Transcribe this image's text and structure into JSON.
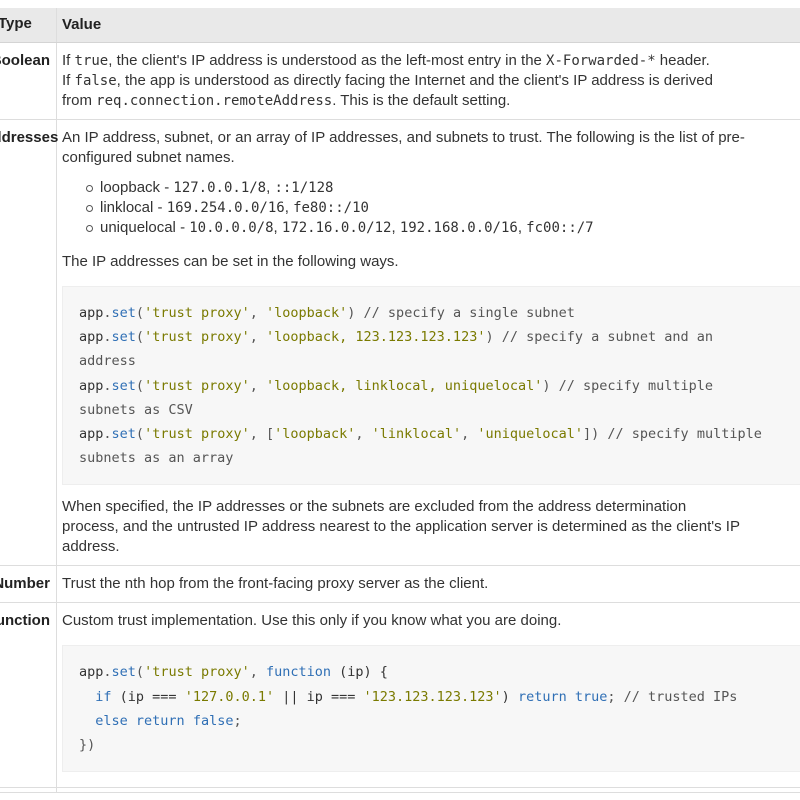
{
  "header": {
    "type": "Type",
    "value": "Value"
  },
  "boolean": {
    "type": "Boolean",
    "l1a": "If ",
    "l1b": "true",
    "l1c": ", the client's IP address is understood as the left-most entry in the ",
    "l1d": "X-Forwarded-*",
    "l1e": " header.",
    "l2a": "If ",
    "l2b": "false",
    "l2c": ", the app is understood as directly facing the Internet and the client's IP address is derived",
    "l3a": "from ",
    "l3b": "req.connection.remoteAddress",
    "l3c": ". This is the default setting."
  },
  "ip": {
    "type": "IP addresses",
    "l1": "An IP address, subnet, or an array of IP addresses, and subnets to trust. The following is the list of pre-",
    "l2": "configured subnet names.",
    "items": [
      {
        "name": "loopback",
        "sep": " - ",
        "a": "127.0.0.1/8",
        "comma": ", ",
        "b": "::1/128"
      },
      {
        "name": "linklocal",
        "sep": " - ",
        "a": "169.254.0.0/16",
        "comma": ", ",
        "b": "fe80::/10"
      },
      {
        "name": "uniquelocal",
        "sep": " - ",
        "a": "10.0.0.0/8",
        "c1": ", ",
        "b": "172.16.0.0/12",
        "c2": ", ",
        "c": "192.168.0.0/16",
        "c3": ", ",
        "d": "fc00::/7"
      }
    ],
    "ways": "The IP addresses can be set in the following ways.",
    "code": {
      "app": "app",
      "dot": ".",
      "set": "set",
      "r1": {
        "open": "(",
        "s1": "'trust proxy'",
        "sep": ", ",
        "s2": "'loopback'",
        "close": ")",
        "cm": " // specify a single subnet"
      },
      "r2": {
        "open": "(",
        "s1": "'trust proxy'",
        "sep": ", ",
        "s2": "'loopback, 123.123.123.123'",
        "close": ")",
        "cm": " // specify a subnet and an",
        "cm2": "address"
      },
      "r3": {
        "open": "(",
        "s1": "'trust proxy'",
        "sep": ", ",
        "s2": "'loopback, linklocal, uniquelocal'",
        "close": ")",
        "cm": " // specify multiple",
        "cm2": "subnets as CSV"
      },
      "r4": {
        "open": "(",
        "s1": "'trust proxy'",
        "sep": ", [",
        "s2": "'loopback'",
        "c1": ", ",
        "s3": "'linklocal'",
        "c2": ", ",
        "s4": "'uniquelocal'",
        "close": "])",
        "cm": " // specify multiple",
        "cm2": "subnets as an array"
      }
    },
    "e1": "When specified, the IP addresses or the subnets are excluded from the address determination",
    "e2": "process, and the untrusted IP address nearest to the application server is determined as the client's IP",
    "e3": "address."
  },
  "number": {
    "type": "Number",
    "text": "Trust the nth hop from the front-facing proxy server as the client."
  },
  "function": {
    "type": "Function",
    "text": "Custom trust implementation. Use this only if you know what you are doing.",
    "code": {
      "app": "app",
      "dot": ".",
      "set": "set",
      "open": "(",
      "s1": "'trust proxy'",
      "sep": ", ",
      "kwfn": "function",
      "args": " (ip) {",
      "indent": "  ",
      "kwif": "if",
      "p1": " (ip === ",
      "s2": "'127.0.0.1'",
      "or": " || ip === ",
      "s3": "'123.123.123.123'",
      "p2": ") ",
      "kwret": "return",
      "tr": " true",
      "semi": ";",
      "cm": " // trusted IPs",
      "kwelse": "else",
      "sp": " ",
      "kwret2": "return",
      "fa": " false",
      "semi2": ";",
      "end": "})"
    }
  }
}
